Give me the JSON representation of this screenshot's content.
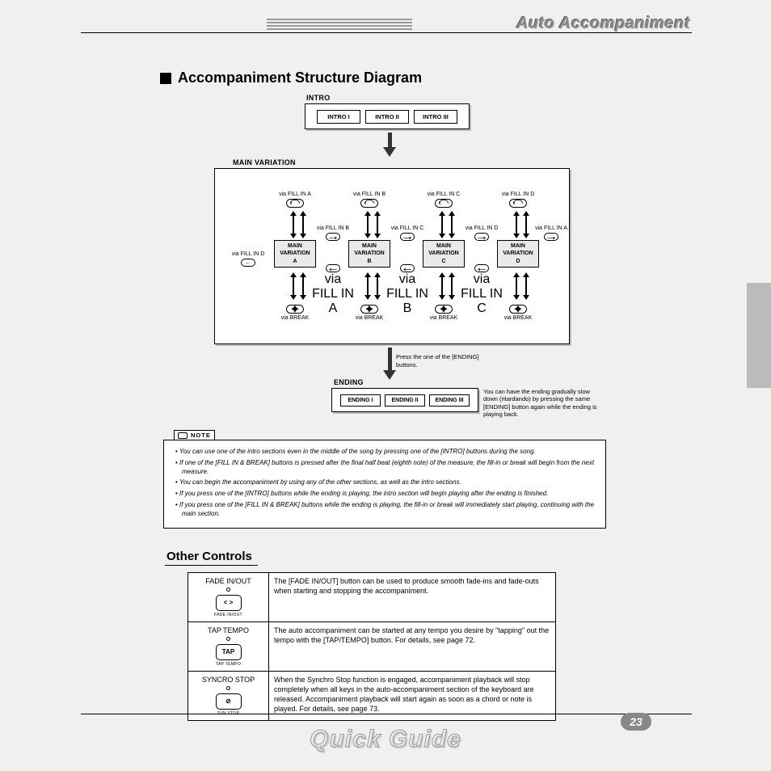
{
  "header": {
    "title": "Auto Accompaniment"
  },
  "section_title": "Accompaniment Structure Diagram",
  "intro": {
    "label": "INTRO",
    "buttons": [
      "INTRO I",
      "INTRO II",
      "INTRO III"
    ]
  },
  "main_variation": {
    "label": "MAIN VARIATION",
    "fill_top": [
      "via FILL IN A",
      "via FILL IN B",
      "via FILL IN C",
      "via FILL IN D"
    ],
    "boxes": [
      "MAIN VARIATION A",
      "MAIN VARIATION B",
      "MAIN VARIATION C",
      "MAIN VARIATION D"
    ],
    "h_top": [
      "via FILL IN B",
      "via FILL IN C",
      "via FILL IN D",
      "via FILL IN A"
    ],
    "h_bot": [
      "via FILL IN A",
      "via FILL IN B",
      "via FILL IN C"
    ],
    "side_left": "via FILL IN D",
    "break": [
      "via BREAK",
      "via BREAK",
      "via BREAK",
      "via BREAK"
    ]
  },
  "ending": {
    "press_note": "Press the one of the [ENDING] buttons.",
    "label": "ENDING",
    "buttons": [
      "ENDING I",
      "ENDING II",
      "ENDING III"
    ],
    "aside": "You can have the ending gradually slow down (ritardando) by pressing the same [ENDING] button again while the ending is playing back."
  },
  "note": {
    "tag": "NOTE",
    "items": [
      "You can use one of the intro sections even in the middle of the song by pressing one of the [INTRO] buttons during the song.",
      "If one of the [FILL IN & BREAK] buttons is pressed after the final half beat (eighth note) of the measure, the fill-in or break will begin from the next measure.",
      "You can begin the accompaniment by using any of the other sections, as well as the intro sections.",
      "If you press one of the [INTRO] buttons while the ending is playing, the intro section will begin playing after the ending is finished.",
      "If you press one of the [FILL IN & BREAK] buttons while the ending is playing, the fill-in or break will immediately start playing, continuing with the main section."
    ]
  },
  "other": {
    "title": "Other Controls",
    "rows": [
      {
        "name": "FADE IN/OUT",
        "btn": "< >",
        "cap": "FADE IN/OUT",
        "desc": "The [FADE IN/OUT] button can be used to produce smooth fade-ins and fade-outs when starting and stopping the accompaniment."
      },
      {
        "name": "TAP TEMPO",
        "btn": "TAP",
        "cap": "TAP TEMPO",
        "desc": "The auto accompaniment can be started at any tempo you desire by \"tapping\" out the tempo with the [TAP/TEMPO] button. For details, see page 72."
      },
      {
        "name": "SYNCRO STOP",
        "btn": "⊘",
        "cap": "SYN.STOP",
        "desc": "When the Synchro Stop function is engaged, accompaniment playback will stop completely when all keys in the auto-accompaniment section of the keyboard are released. Accompaniment playback will start again as soon as a chord or note is played.  For details, see page 73."
      }
    ]
  },
  "footer": {
    "page": "23",
    "title": "Quick Guide"
  }
}
